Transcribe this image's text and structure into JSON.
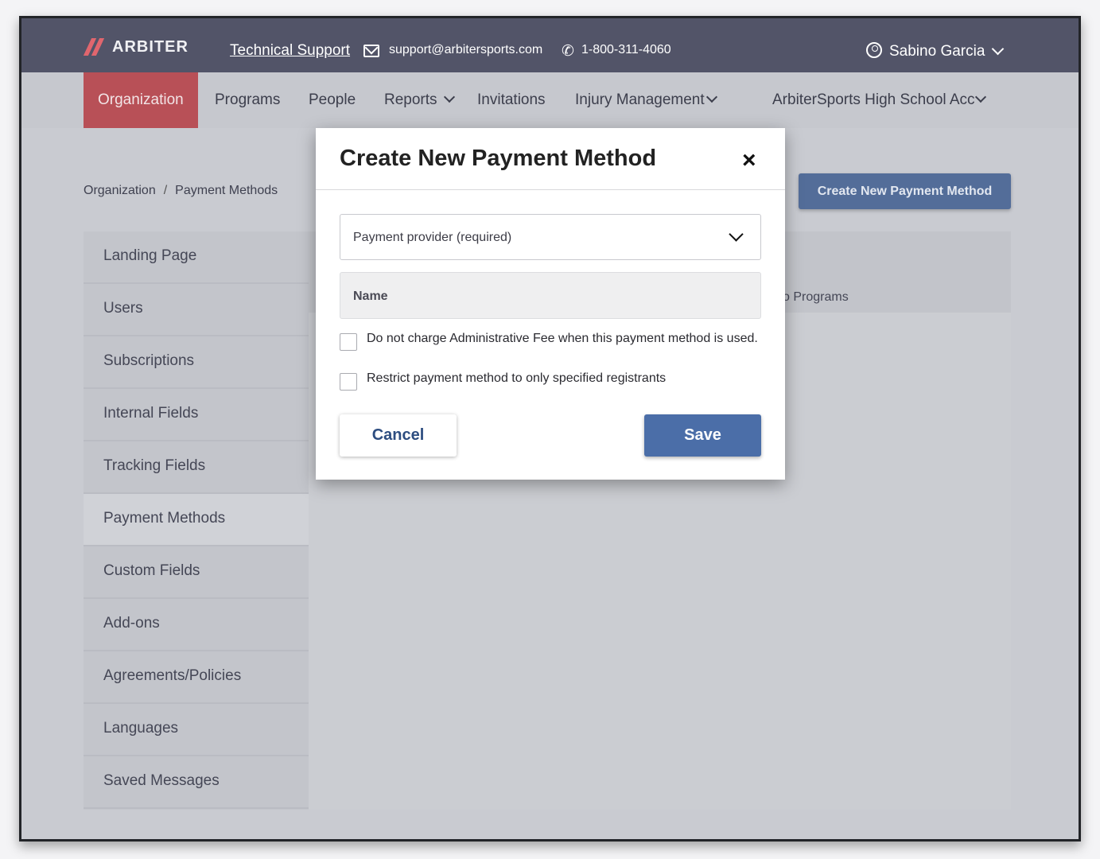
{
  "header": {
    "logo_text": "ARBITER",
    "support_link": "Technical Support",
    "support_email": "support@arbitersports.com",
    "support_phone": "1-800-311-4060",
    "user_name": "Sabino Garcia"
  },
  "nav": {
    "items": [
      {
        "label": "Organization",
        "active": true
      },
      {
        "label": "Programs"
      },
      {
        "label": "People"
      },
      {
        "label": "Reports",
        "dropdown": true
      },
      {
        "label": "Invitations"
      },
      {
        "label": "Injury Management",
        "dropdown": true
      },
      {
        "label": "ArbiterSports High School Acc",
        "dropdown": true
      }
    ]
  },
  "breadcrumb": {
    "items": [
      "Organization",
      "Payment Methods"
    ],
    "separator": "/"
  },
  "header_button": "Create New Payment Method",
  "sidebar": {
    "items": [
      {
        "label": "Landing Page"
      },
      {
        "label": "Users"
      },
      {
        "label": "Subscriptions"
      },
      {
        "label": "Internal Fields"
      },
      {
        "label": "Tracking Fields"
      },
      {
        "label": "Payment Methods",
        "active": true
      },
      {
        "label": "Custom Fields"
      },
      {
        "label": "Add-ons"
      },
      {
        "label": "Agreements/Policies"
      },
      {
        "label": "Languages"
      },
      {
        "label": "Saved Messages"
      }
    ]
  },
  "table": {
    "partial_header": "o Programs"
  },
  "modal": {
    "title": "Create New Payment Method",
    "close": "×",
    "provider_placeholder": "Payment provider (required)",
    "name_label": "Name",
    "checkbox_admin_fee": "Do not charge Administrative Fee when this payment method is used.",
    "checkbox_restrict": "Restrict payment method to only specified registrants",
    "cancel_label": "Cancel",
    "save_label": "Save"
  },
  "colors": {
    "topbar": "#525468",
    "nav_active": "#b85057",
    "primary_button": "#4b6ea8"
  }
}
